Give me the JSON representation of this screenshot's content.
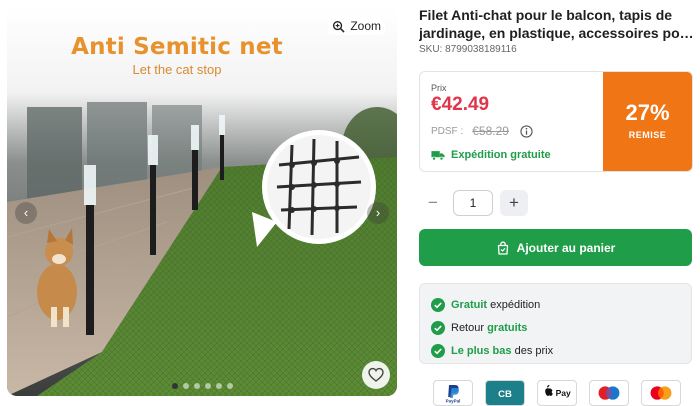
{
  "gallery": {
    "zoom_label": "Zoom",
    "headline": "Anti Semitic net",
    "subline": "Let the cat stop",
    "slide_count": 6,
    "active_slide": 1
  },
  "product": {
    "title_line1": "Filet Anti-chat pour le balcon, tapis de",
    "title_line2": "jardinage, en plastique, accessoires pour...",
    "sku": "SKU: 8799038189116"
  },
  "pricing": {
    "price_label": "Prix",
    "price": "€42.49",
    "pdsf_label": "PDSF :",
    "pdsf_value": "€58.29",
    "shipping_label": "Expédition gratuite",
    "discount_percent": "27%",
    "discount_label": "REMISE",
    "discount_color": "#f07514",
    "price_color": "#e0344b"
  },
  "quantity": {
    "value": "1",
    "minus": "−",
    "plus": "+"
  },
  "cart": {
    "label": "Ajouter au panier",
    "color": "#1f9d48"
  },
  "benefits": [
    {
      "bold": "Gratuit",
      "rest": " expédition",
      "bold_first": true
    },
    {
      "rest": "Retour ",
      "bold": "gratuits",
      "bold_first": false
    },
    {
      "bold": "Le plus bas",
      "rest": " des prix",
      "bold_first": true
    }
  ],
  "payments": [
    {
      "name": "PayPal",
      "icon": "paypal-icon"
    },
    {
      "name": "CB",
      "icon": "carte-bancaire-icon"
    },
    {
      "name": "Apple Pay",
      "icon": "apple-pay-icon"
    },
    {
      "name": "Maestro",
      "icon": "maestro-icon"
    },
    {
      "name": "Mastercard",
      "icon": "mastercard-icon"
    }
  ]
}
